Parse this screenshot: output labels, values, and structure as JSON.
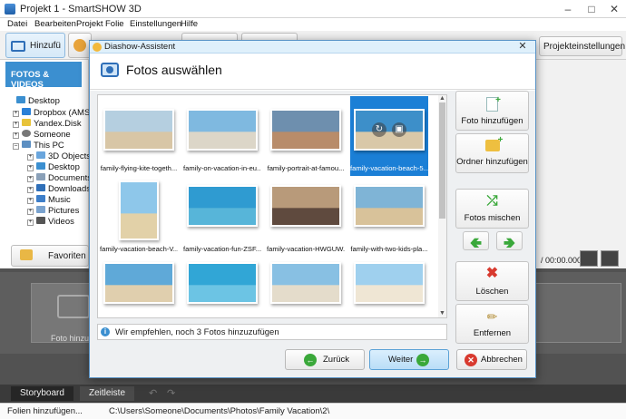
{
  "app": {
    "title": "Projekt 1 - SmartSHOW 3D",
    "menu": [
      "Datei",
      "Bearbeiten",
      "Projekt",
      "Folie",
      "Einstellungen",
      "Hilfe"
    ],
    "tab_add": "Hinzufü",
    "projektsettings": "Projekteinstellungen",
    "fotos_videos": "FOTOS & VIDEOS",
    "tree": [
      "Desktop",
      "Dropbox (AMS",
      "Yandex.Disk",
      "Someone",
      "This PC",
      "3D Objects",
      "Desktop",
      "Documents",
      "Downloads",
      "Music",
      "Pictures",
      "Videos"
    ],
    "favoriten": "Favoriten",
    "timecode": "/ 00:00.000",
    "foto_hinzufuegen_placeholder": "Foto hinzuf",
    "tab_storyboard": "Storyboard",
    "tab_zeitleiste": "Zeitleiste",
    "status_left": "Folien hinzufügen...",
    "status_path": "C:\\Users\\Someone\\Documents\\Photos\\Family Vacation\\2\\"
  },
  "dialog": {
    "window_title": "Diashow-Assistent",
    "heading": "Fotos auswählen",
    "info": "Wir empfehlen, noch 3 Fotos hinzuzufügen",
    "photos": [
      {
        "name": "family-flying-kite-togeth...",
        "selected": false
      },
      {
        "name": "family-on-vacation-in-eu...",
        "selected": false
      },
      {
        "name": "family-portrait-at-famou...",
        "selected": false
      },
      {
        "name": "family-vacation-beach-5...",
        "selected": true
      },
      {
        "name": "family-vacation-beach-V...",
        "selected": false
      },
      {
        "name": "family-vacation-fun-ZSF...",
        "selected": false
      },
      {
        "name": "family-vacation-HWGUW...",
        "selected": false
      },
      {
        "name": "family-with-two-kids-pla...",
        "selected": false
      },
      {
        "name": "",
        "selected": false
      },
      {
        "name": "",
        "selected": false
      },
      {
        "name": "",
        "selected": false
      },
      {
        "name": "",
        "selected": false
      }
    ],
    "side_buttons": {
      "add_photo": "Foto hinzufügen",
      "add_folder": "Ordner hinzufügen",
      "shuffle": "Fotos mischen",
      "delete": "Löschen",
      "remove": "Entfernen"
    },
    "nav": {
      "back": "Zurück",
      "next": "Weiter",
      "cancel": "Abbrechen"
    }
  },
  "colors": {
    "accent": "#3b8fd0",
    "selected": "#1b7fd6",
    "next_button": "#c9e6fb",
    "green": "#3aa83a",
    "red": "#d83a2f"
  }
}
